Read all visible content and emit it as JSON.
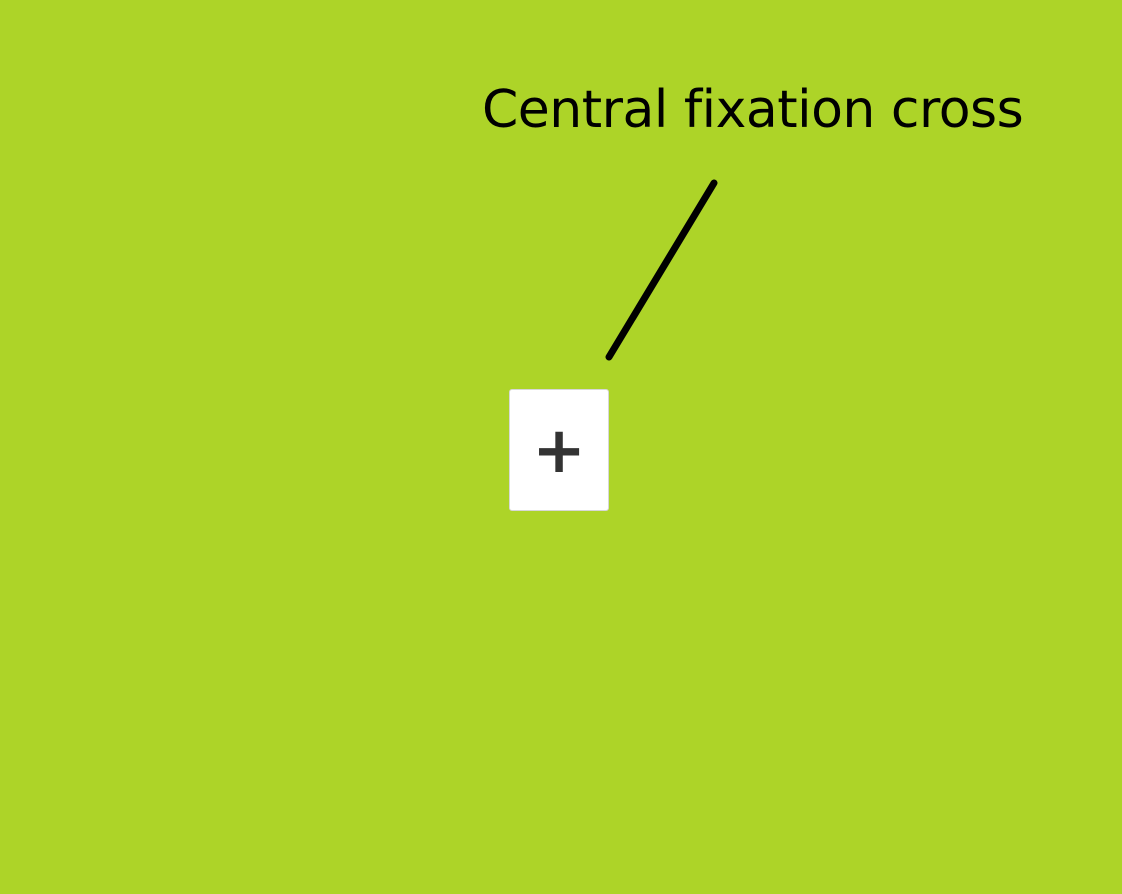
{
  "annotation": {
    "label": "Central fixation cross"
  },
  "fixation": {
    "symbol": "+",
    "icon": "plus-icon"
  },
  "colors": {
    "background": "#add428",
    "card": "#ffffff",
    "cross": "#333333",
    "line": "#000000"
  }
}
